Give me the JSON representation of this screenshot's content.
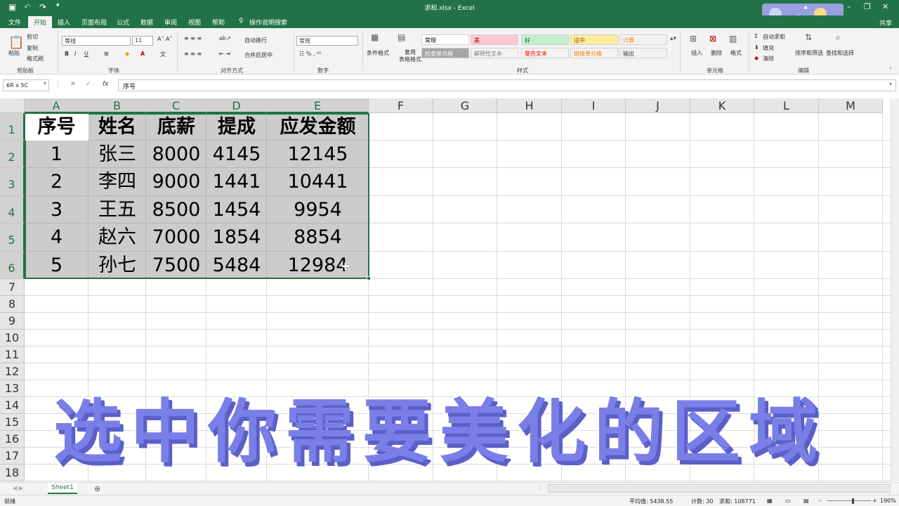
{
  "titlebar": {
    "title": "求和.xlsx  -  Excel"
  },
  "tabs": [
    "文件",
    "开始",
    "插入",
    "页面布局",
    "公式",
    "数据",
    "审阅",
    "视图",
    "帮助"
  ],
  "tellme": "操作说明搜索",
  "share": "共享",
  "ribbon": {
    "clipboard": {
      "paste": "粘贴",
      "cut": "剪切",
      "copy": "复制",
      "format_painter": "格式刷",
      "group": "剪贴板"
    },
    "font": {
      "name": "等线",
      "size": "11",
      "group": "字体"
    },
    "alignment": {
      "wrap": "自动换行",
      "merge": "合并后居中",
      "group": "对齐方式"
    },
    "number": {
      "format": "常规",
      "group": "数字"
    },
    "styles": {
      "conditional": "条件格式",
      "as_table": "套用\n表格格式",
      "group": "样式",
      "cells": [
        {
          "label": "常规",
          "bg": "#ffffff",
          "fg": "#000000"
        },
        {
          "label": "差",
          "bg": "#ffc7ce",
          "fg": "#9c0006"
        },
        {
          "label": "好",
          "bg": "#c6efce",
          "fg": "#006100"
        },
        {
          "label": "适中",
          "bg": "#ffeb9c",
          "fg": "#9c5700"
        },
        {
          "label": "计算",
          "bg": "#f2f2f2",
          "fg": "#fa7d00"
        },
        {
          "label": "检查单元格",
          "bg": "#a5a5a5",
          "fg": "#ffffff"
        },
        {
          "label": "解释性文本",
          "bg": "#f3f3f3",
          "fg": "#7f7f7f"
        },
        {
          "label": "警告文本",
          "bg": "#f3f3f3",
          "fg": "#ff0000"
        },
        {
          "label": "链接单元格",
          "bg": "#f3f3f3",
          "fg": "#fa7d00"
        },
        {
          "label": "输出",
          "bg": "#f2f2f2",
          "fg": "#3f3f3f"
        }
      ]
    },
    "cells": {
      "insert": "插入",
      "delete": "删除",
      "format": "格式",
      "group": "单元格"
    },
    "editing": {
      "autosum": "自动求和",
      "fill": "填充",
      "clear": "清除",
      "sort": "排序和筛选",
      "find": "查找和选择",
      "group": "编辑"
    }
  },
  "formula_bar": {
    "name_box": "6R x 5C",
    "fx": "fx",
    "content": "序号"
  },
  "columns": [
    "A",
    "B",
    "C",
    "D",
    "E",
    "F",
    "G",
    "H",
    "I",
    "J",
    "K",
    "L",
    "M"
  ],
  "rows": [
    "1",
    "2",
    "3",
    "4",
    "5",
    "6",
    "7",
    "8",
    "9",
    "10",
    "11",
    "12",
    "13",
    "14",
    "15",
    "16",
    "17",
    "18"
  ],
  "table": {
    "headers": [
      "序号",
      "姓名",
      "底薪",
      "提成",
      "应发金额"
    ],
    "rows": [
      [
        "1",
        "张三",
        "8000",
        "4145",
        "12145"
      ],
      [
        "2",
        "李四",
        "9000",
        "1441",
        "10441"
      ],
      [
        "3",
        "王五",
        "8500",
        "1454",
        "9954"
      ],
      [
        "4",
        "赵六",
        "7000",
        "1854",
        "8854"
      ],
      [
        "5",
        "孙七",
        "7500",
        "5484",
        "12984"
      ]
    ]
  },
  "caption": "选中你需要美化的区域",
  "sheet_tab": "Sheet1",
  "status": {
    "ready": "就绪",
    "average": "平均值: 5438.55",
    "count": "计数: 30",
    "sum": "求和: 108771",
    "zoom": "190%"
  },
  "accent": "#217346"
}
